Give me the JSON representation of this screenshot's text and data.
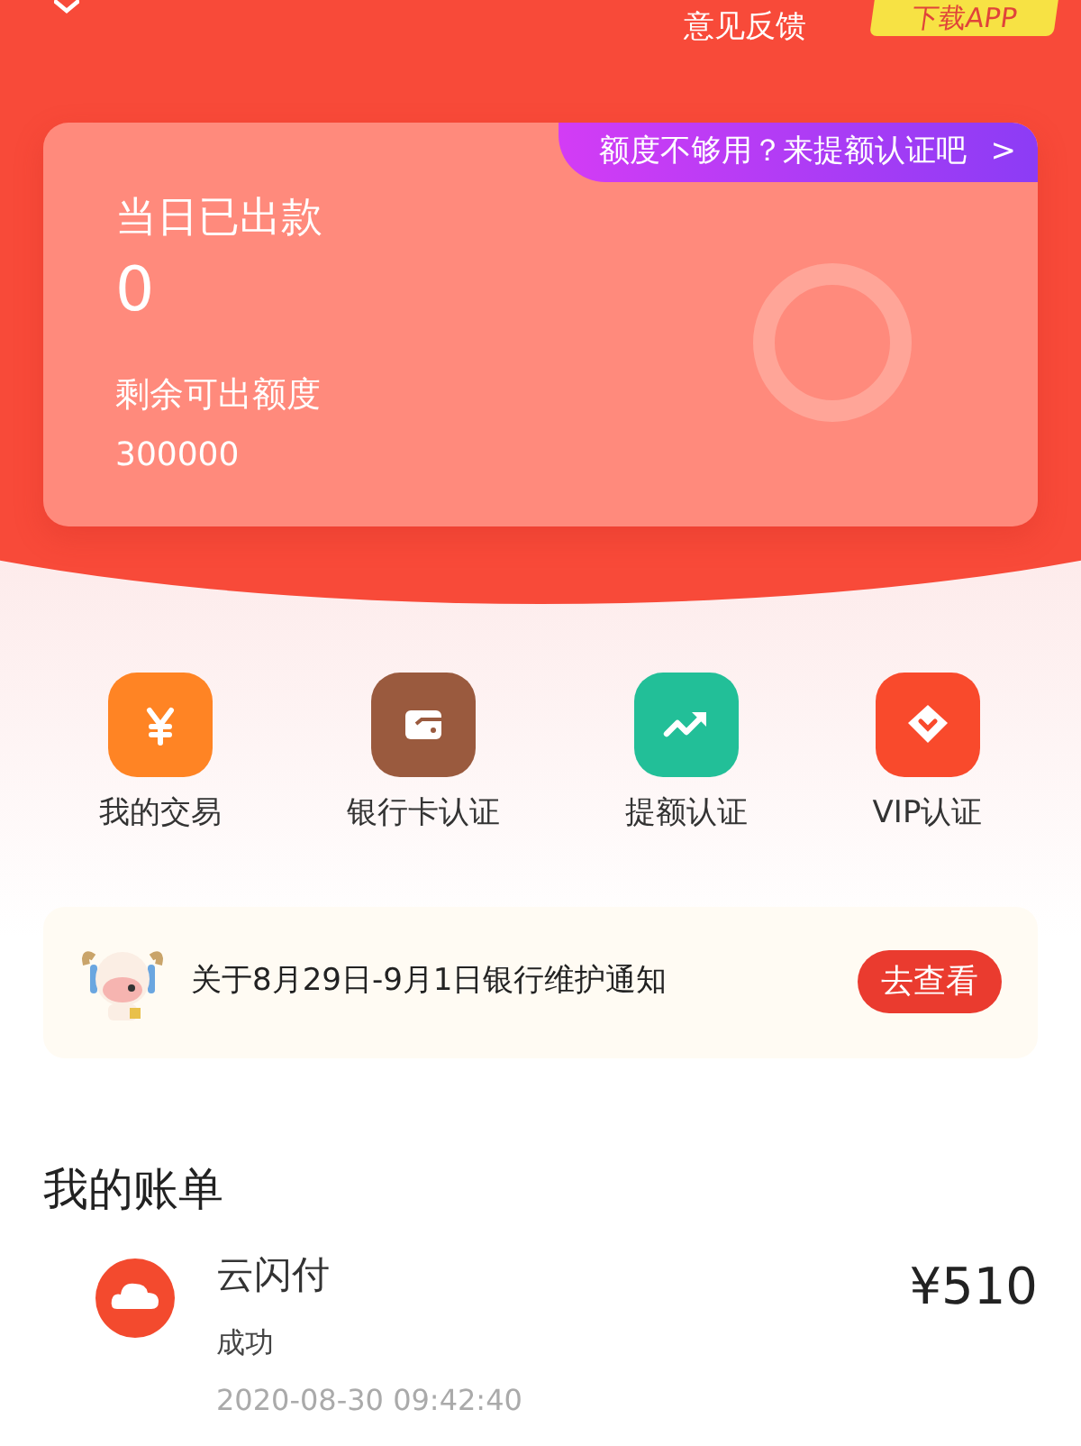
{
  "header": {
    "feedback": "意见反馈",
    "download_button": "下载APP"
  },
  "quota_card": {
    "banner": "额度不够用？来提额认证吧",
    "banner_chevron": ">",
    "paid_today_label": "当日已出款",
    "paid_today": "0",
    "remaining_label": "剩余可出额度",
    "remaining": "300000"
  },
  "shortcuts": [
    {
      "label": "我的交易",
      "kind": "yuan",
      "color": "#ff8424"
    },
    {
      "label": "银行卡认证",
      "kind": "wallet",
      "color": "#9a5a3e"
    },
    {
      "label": "提额认证",
      "kind": "trend",
      "color": "#22bf98"
    },
    {
      "label": "VIP认证",
      "kind": "gem",
      "color": "#f94a2c"
    }
  ],
  "notice": {
    "text": "关于8月29日-9月1日银行维护通知",
    "button": "去查看"
  },
  "bills": {
    "title": "我的账单",
    "items": [
      {
        "name": "云闪付",
        "status": "成功",
        "time": "2020-08-30 09:42:40",
        "amount": "¥510"
      }
    ]
  }
}
